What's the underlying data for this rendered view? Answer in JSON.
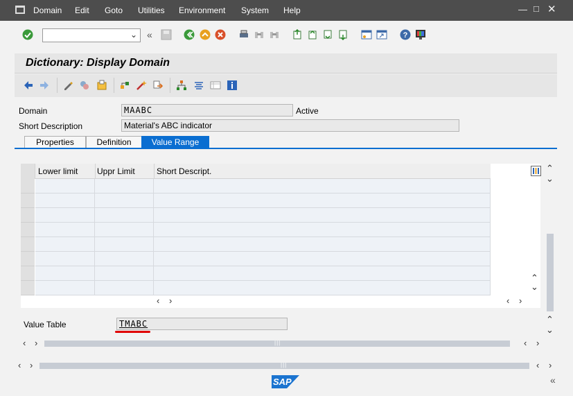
{
  "menu": {
    "items": [
      "Domain",
      "Edit",
      "Goto",
      "Utilities",
      "Environment",
      "System",
      "Help"
    ]
  },
  "title": "Dictionary: Display Domain",
  "fields": {
    "domain_label": "Domain",
    "domain_value": "MAABC",
    "domain_status": "Active",
    "short_desc_label": "Short Description",
    "short_desc_value": "Material's ABC indicator"
  },
  "tabs": [
    {
      "label": "Properties",
      "active": false
    },
    {
      "label": "Definition",
      "active": false
    },
    {
      "label": "Value Range",
      "active": true
    }
  ],
  "table": {
    "columns": [
      "Lower limit",
      "Uppr Limit",
      "Short Descript."
    ],
    "rows": 8
  },
  "value_table": {
    "label": "Value Table",
    "value": "TMABC"
  },
  "colors": {
    "accent": "#0a6ed1",
    "menubar": "#4d4d4d",
    "underline": "#e00000"
  },
  "footer": {
    "logo": "SAP"
  }
}
